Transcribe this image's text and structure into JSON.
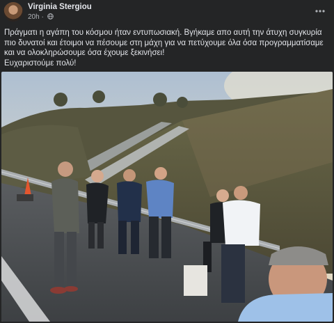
{
  "post": {
    "author": "Virginia Stergiou",
    "time": "20h",
    "separator": "·",
    "privacy_icon": "globe-icon",
    "more_icon": "more-horizontal-icon",
    "text_lines": [
      "Πράγματι η αγάπη του κόσμου ήταν εντυπωσιακή. Βγήκαμε απο αυτή την άτυχη συγκυρία πιο δυνατοί και έτοιμοι να πέσουμε στη μάχη για να πετύχουμε όλα όσα προγραμματίσαμε και να ολοκληρώσουμε όσα έχουμε ξεκινήσει!",
      "Ευχαριστούμε πολύ!"
    ]
  },
  "colors": {
    "background": "#242526",
    "primary_text": "#e4e6eb",
    "secondary_text": "#b0b3b8"
  }
}
